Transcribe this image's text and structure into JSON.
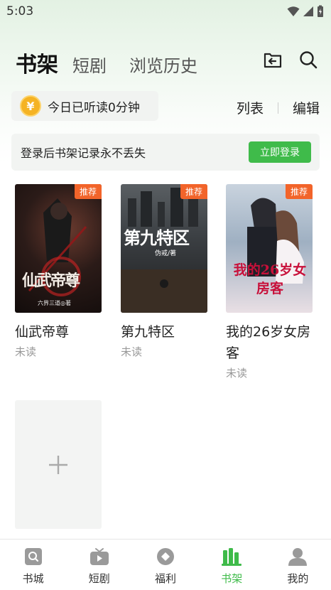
{
  "status_bar": {
    "time": "5:03"
  },
  "header": {
    "tabs": [
      {
        "label": "书架",
        "active": true
      },
      {
        "label": "短剧",
        "active": false
      },
      {
        "label": "浏览历史",
        "active": false
      }
    ],
    "icons": [
      "import-icon",
      "search-icon"
    ]
  },
  "listen": {
    "text": "今日已听读0分钟",
    "coin_symbol": "¥"
  },
  "view_actions": {
    "list_label": "列表",
    "edit_label": "编辑"
  },
  "login_banner": {
    "text": "登录后书架记录永不丢失",
    "button_label": "立即登录"
  },
  "books": [
    {
      "title": "仙武帝尊",
      "status": "未读",
      "badge": "推荐",
      "cover_text": "仙武帝尊",
      "cover_author": "六界三道◎著"
    },
    {
      "title": "第九特区",
      "status": "未读",
      "badge": "推荐",
      "cover_text": "第九特区",
      "cover_author": "伪戒/著"
    },
    {
      "title": "我的26岁女房客",
      "status": "未读",
      "badge": "推荐",
      "cover_text": "我的26岁女房客",
      "cover_author": ""
    }
  ],
  "add_tile": {
    "symbol": "+"
  },
  "bottom_nav": [
    {
      "label": "书城",
      "icon": "bookstore-icon",
      "active": false
    },
    {
      "label": "短剧",
      "icon": "tv-icon",
      "active": false
    },
    {
      "label": "福利",
      "icon": "welfare-icon",
      "active": false
    },
    {
      "label": "书架",
      "icon": "bookshelf-icon",
      "active": true
    },
    {
      "label": "我的",
      "icon": "profile-icon",
      "active": false
    }
  ],
  "colors": {
    "accent": "#3fbb4a",
    "badge": "#f2642a",
    "coin": "#f5b324"
  }
}
